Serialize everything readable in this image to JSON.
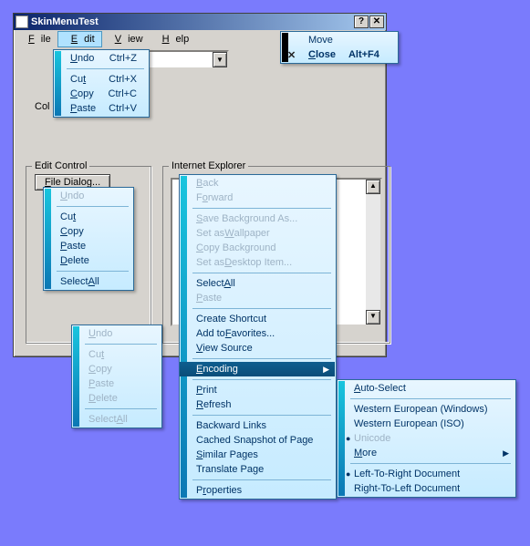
{
  "window": {
    "title": "SkinMenuTest",
    "help_btn_glyph": "?",
    "close_btn_glyph": "✕"
  },
  "menubar": {
    "file": "File",
    "file_u": "F",
    "edit": "Edit",
    "edit_u": "E",
    "view": "View",
    "view_u": "V",
    "help": "Help",
    "help_u": "H"
  },
  "labels": {
    "color": "Col",
    "file_dialog": "File Dialog...",
    "edit_control": "Edit Control",
    "internet_explorer": "Internet Explorer"
  },
  "sysmenu": {
    "move": "Move",
    "close": "Close",
    "close_shortcut": "Alt+F4",
    "close_glyph": "✕"
  },
  "editmenu": {
    "undo": "Undo",
    "undo_sc": "Ctrl+Z",
    "undo_u": "U",
    "cut": "Cut",
    "cut_sc": "Ctrl+X",
    "cut_u": "t",
    "copy": "Copy",
    "copy_sc": "Ctrl+C",
    "copy_u": "C",
    "paste": "Paste",
    "paste_sc": "Ctrl+V",
    "paste_u": "P"
  },
  "editctx": {
    "undo": "Undo",
    "undo_u": "U",
    "cut": "Cut",
    "cut_u": "t",
    "copy": "Copy",
    "copy_u": "C",
    "paste": "Paste",
    "paste_u": "P",
    "delete": "Delete",
    "delete_u": "D",
    "select_all": "Select All",
    "select_all_u": "A"
  },
  "iemenu": {
    "back": "Back",
    "back_u": "B",
    "forward": "Forward",
    "forward_u": "o",
    "save_bg": "Save Background As...",
    "save_bg_u": "S",
    "set_wall": "Set as Wallpaper",
    "set_wall_u": "W",
    "copy_bg": "Copy Background",
    "copy_bg_u": "C",
    "set_desk": "Set as Desktop Item...",
    "set_desk_u": "D",
    "select_all": "Select All",
    "select_all_u": "A",
    "paste": "Paste",
    "paste_u": "P",
    "create_sc": "Create Shortcut",
    "add_fav": "Add to Favorites...",
    "add_fav_u": "F",
    "view_source": "View Source",
    "view_source_u": "V",
    "encoding": "Encoding",
    "encoding_u": "E",
    "print": "Print",
    "print_u": "P",
    "refresh": "Refresh",
    "refresh_u": "R",
    "backward": "Backward Links",
    "cached": "Cached Snapshot of Page",
    "similar": "Similar Pages",
    "similar_u": "S",
    "translate": "Translate Page",
    "properties": "Properties",
    "properties_u": "r"
  },
  "encmenu": {
    "auto": "Auto-Select",
    "auto_u": "A",
    "wewin": "Western European (Windows)",
    "weiso": "Western European (ISO)",
    "unicode": "Unicode",
    "more": "More",
    "more_u": "M",
    "ltr": "Left-To-Right Document",
    "rtl": "Right-To-Left Document"
  }
}
